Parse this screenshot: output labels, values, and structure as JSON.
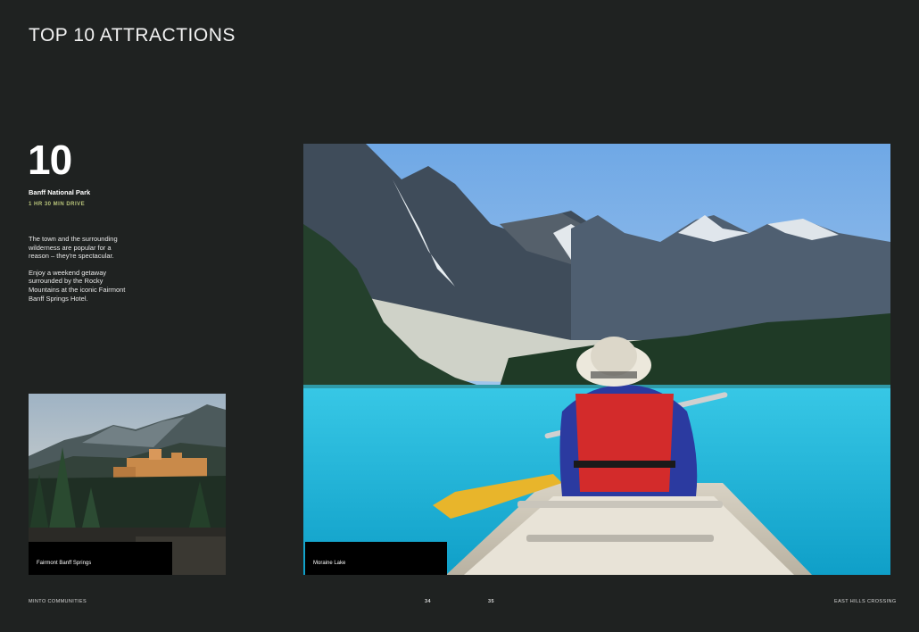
{
  "page": {
    "title": "TOP 10 ATTRACTIONS"
  },
  "attraction": {
    "rank": "10",
    "name": "Banff National Park",
    "drive_time": "1 HR 30 MIN DRIVE",
    "description": [
      "The town and the surrounding wilderness are popular for a reason – they're spectacular.",
      "Enjoy a weekend getaway surrounded by the Rocky Mountains at the iconic Fairmont Banff Springs Hotel."
    ]
  },
  "photos": {
    "small": {
      "caption": "Fairmont Banff Springs"
    },
    "large": {
      "caption": "Moraine Lake"
    }
  },
  "footer": {
    "left": "MINTO COMMUNITIES",
    "page_left": "34",
    "page_right": "35",
    "right": "EAST HILLS CROSSING"
  },
  "colors": {
    "background": "#1f2221",
    "accent": "#b8c47a",
    "lake": "#1fb6d6"
  }
}
